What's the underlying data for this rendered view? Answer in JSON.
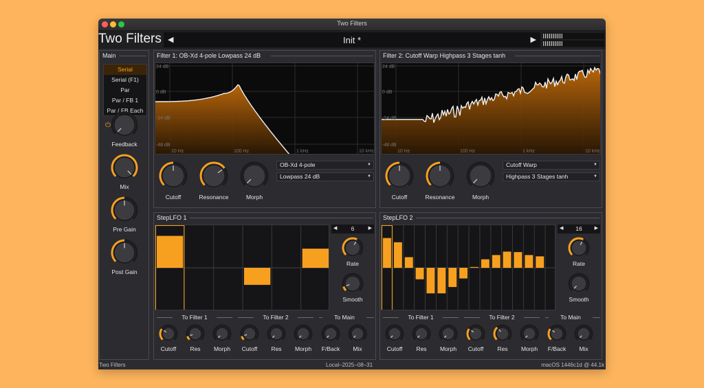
{
  "window": {
    "title": "Two Filters"
  },
  "header": {
    "app_title": "Two Filters",
    "preset": "Init *",
    "prev_icon": "triangle-left",
    "next_icon": "triangle-right",
    "vu_levels": [
      0.32,
      0.32
    ]
  },
  "main": {
    "title": "Main",
    "modes": [
      "Serial",
      "Serial (F1)",
      "Par",
      "Par / FB 1",
      "Par / FB Each"
    ],
    "selected_mode": "Serial",
    "knobs": [
      {
        "label": "Feedback",
        "value": 0.0
      },
      {
        "label": "Mix",
        "value": 1.0
      },
      {
        "label": "Pre Gain",
        "value": 0.5
      },
      {
        "label": "Post Gain",
        "value": 0.5
      }
    ]
  },
  "filter1": {
    "title": "Filter 1: OB-Xd 4-pole Lowpass 24 dB",
    "db_labels": [
      "24 dB",
      "0 dB",
      "-24 dB",
      "-48 dB"
    ],
    "freq_labels": [
      "10 Hz",
      "100 Hz",
      "1 kHz",
      "10 kHz"
    ],
    "knobs": [
      {
        "label": "Cutoff",
        "value": 0.5
      },
      {
        "label": "Resonance",
        "value": 0.7
      },
      {
        "label": "Morph",
        "value": 0.0
      }
    ],
    "model": "OB-Xd 4-pole",
    "type": "Lowpass 24 dB"
  },
  "filter2": {
    "title": "Filter 2: Cutoff Warp Highpass 3 Stages tanh",
    "db_labels": [
      "24 dB",
      "0 dB",
      "-24 dB",
      "-48 dB"
    ],
    "freq_labels": [
      "10 Hz",
      "100 Hz",
      "1 kHz",
      "10 kHz"
    ],
    "knobs": [
      {
        "label": "Cutoff",
        "value": 0.5
      },
      {
        "label": "Resonance",
        "value": 0.5
      },
      {
        "label": "Morph",
        "value": 0.0
      }
    ],
    "model": "Cutoff Warp",
    "type": "Highpass 3 Stages tanh"
  },
  "lfo1": {
    "title": "StepLFO 1",
    "steps_count": "6",
    "steps": [
      0.75,
      0,
      0,
      -0.4,
      0,
      0.45
    ],
    "rate_label": "Rate",
    "rate_value": 0.6,
    "smooth_label": "Smooth",
    "smooth_value": 0.1,
    "sections": [
      "To Filter 1",
      "To Filter 2",
      "To Main"
    ],
    "mod_knobs": [
      {
        "label": "Cutoff",
        "value": 0.3
      },
      {
        "label": "Res",
        "value": 0.1
      },
      {
        "label": "Morph",
        "value": 0.0
      },
      {
        "label": "Cutoff",
        "value": 0.1
      },
      {
        "label": "Res",
        "value": 0.0
      },
      {
        "label": "Morph",
        "value": 0.0
      },
      {
        "label": "F/Back",
        "value": 0.0
      },
      {
        "label": "Mix",
        "value": 0.0
      }
    ]
  },
  "lfo2": {
    "title": "StepLFO 2",
    "steps_count": "16",
    "steps": [
      0.7,
      0.6,
      0.25,
      -0.27,
      -0.6,
      -0.6,
      -0.45,
      -0.25,
      0.02,
      0.2,
      0.3,
      0.38,
      0.37,
      0.3,
      0.27,
      0
    ],
    "rate_label": "Rate",
    "rate_value": 0.6,
    "smooth_label": "Smooth",
    "smooth_value": 0.0,
    "sections": [
      "To Filter 1",
      "To Filter 2",
      "To Main"
    ],
    "mod_knobs": [
      {
        "label": "Cutoff",
        "value": 0.0
      },
      {
        "label": "Res",
        "value": 0.0
      },
      {
        "label": "Morph",
        "value": 0.0
      },
      {
        "label": "Cutoff",
        "value": 0.3
      },
      {
        "label": "Res",
        "value": 0.35
      },
      {
        "label": "Morph",
        "value": 0.0
      },
      {
        "label": "F/Back",
        "value": 0.3
      },
      {
        "label": "Mix",
        "value": 0.0
      }
    ]
  },
  "status": {
    "left": "Two Filters",
    "center": "Local–2025–08–31",
    "right": "macOS 1446c1d @ 44.1k"
  },
  "colors": {
    "accent": "#F7A020",
    "background": "#FDB45C",
    "panel": "#2B2B30"
  }
}
